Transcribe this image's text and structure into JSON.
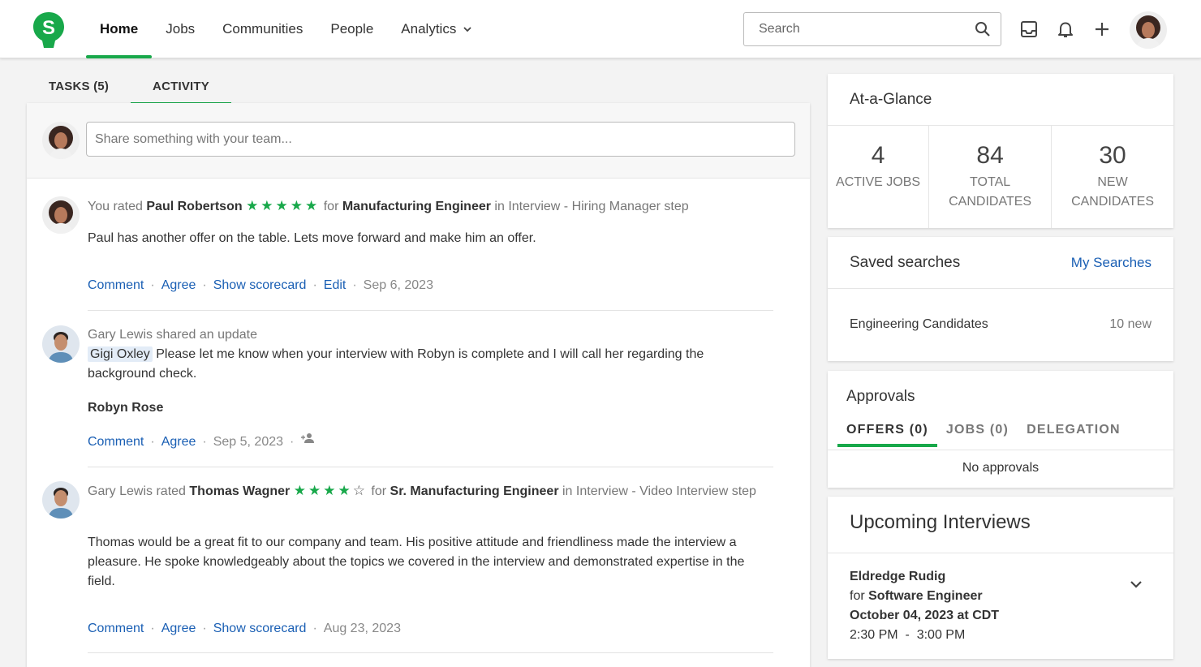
{
  "nav": {
    "items": [
      "Home",
      "Jobs",
      "Communities",
      "People",
      "Analytics"
    ],
    "search_placeholder": "Search"
  },
  "tabs": [
    "TASKS (5)",
    "ACTIVITY"
  ],
  "composer": {
    "placeholder": "Share something with your team..."
  },
  "feed": [
    {
      "prefix": "You rated",
      "name": "Paul Robertson",
      "stars": "★★★★★",
      "for": "for",
      "job": "Manufacturing Engineer",
      "step": "in Interview - Hiring Manager step",
      "text": "Paul has another offer on the table. Lets move forward and make him an offer.",
      "actions": [
        "Comment",
        "Agree",
        "Show scorecard",
        "Edit"
      ],
      "date": "Sep 6, 2023"
    },
    {
      "header": "Gary Lewis shared an update",
      "mention": "Gigi Oxley",
      "text": "Please let me know when your interview with Robyn is complete and I will call her regarding the background check.",
      "subject": "Robyn Rose",
      "actions": [
        "Comment",
        "Agree"
      ],
      "date": "Sep 5, 2023"
    },
    {
      "prefix": "Gary Lewis rated",
      "name": "Thomas Wagner",
      "stars": "★★★★",
      "empty_star": "☆",
      "for": "for",
      "job": "Sr. Manufacturing Engineer",
      "step": "in Interview - Video Interview step",
      "text": "Thomas would be a great fit to our company and team. His positive attitude and friendliness made the interview a pleasure. He spoke knowledgeably about the topics we covered in the interview and demonstrated expertise in the field.",
      "actions": [
        "Comment",
        "Agree",
        "Show scorecard"
      ],
      "date": "Aug 23, 2023"
    }
  ],
  "glance": {
    "title": "At-a-Glance",
    "stats": [
      {
        "num": "4",
        "label": "ACTIVE JOBS"
      },
      {
        "num": "84",
        "label": "TOTAL CANDIDATES"
      },
      {
        "num": "30",
        "label": "NEW CANDIDATES"
      }
    ]
  },
  "saved": {
    "title": "Saved searches",
    "link": "My Searches",
    "item": "Engineering Candidates",
    "count": "10 new"
  },
  "approvals": {
    "title": "Approvals",
    "tabs": [
      "OFFERS (0)",
      "JOBS (0)",
      "DELEGATION"
    ],
    "empty": "No approvals"
  },
  "interviews": {
    "title": "Upcoming Interviews",
    "name": "Eldredge Rudig",
    "for_label": "for",
    "job": "Software Engineer",
    "date": "October 04, 2023 at CDT",
    "time": "2:30 PM  -  3:00 PM"
  },
  "colors": {
    "accent": "#18a84a",
    "link": "#1a5fb4"
  }
}
